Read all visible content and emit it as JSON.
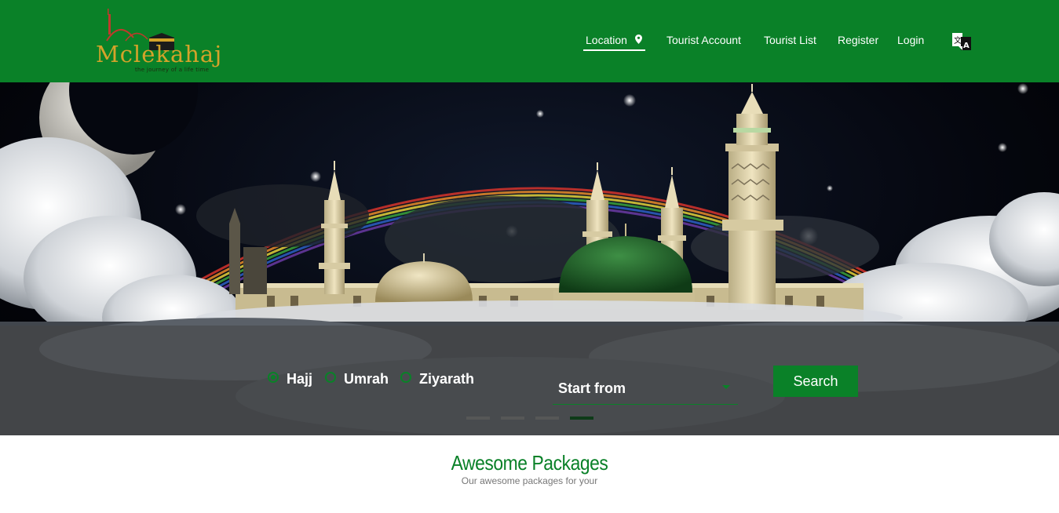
{
  "brand": {
    "logo_text": "Mclekahaj",
    "tagline": "the journey of a life time"
  },
  "nav": {
    "items": [
      {
        "label": "Location",
        "icon": "map-pin-icon",
        "active": true
      },
      {
        "label": "Tourist Account"
      },
      {
        "label": "Tourist List"
      },
      {
        "label": "Register"
      },
      {
        "label": "Login"
      }
    ],
    "language_icon": "translate-icon"
  },
  "search": {
    "trip_types": [
      {
        "label": "Hajj",
        "checked": true
      },
      {
        "label": "Umrah",
        "checked": false
      },
      {
        "label": "Ziyarath",
        "checked": false
      }
    ],
    "start_select": {
      "value": "Start from"
    },
    "search_button": "Search"
  },
  "carousel": {
    "slide_count": 4,
    "active_slide": 4
  },
  "packages": {
    "title": "Awesome Packages",
    "subtitle": "Our awesome packages for your"
  },
  "colors": {
    "brand_green": "#0a8128",
    "logo_gold": "#d4a32a",
    "dome_green": "#1c5a26"
  }
}
